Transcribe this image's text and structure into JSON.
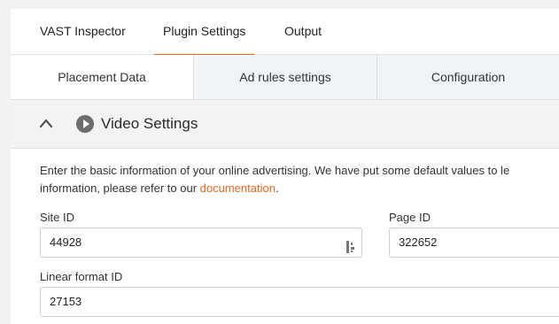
{
  "top_tabs": [
    "VAST Inspector",
    "Plugin Settings",
    "Output"
  ],
  "active_top_tab": "Plugin Settings",
  "sub_tabs": [
    "Placement Data",
    "Ad rules settings",
    "Configuration"
  ],
  "section": {
    "title": "Video Settings"
  },
  "description": {
    "line1": "Enter the basic information of your online advertising. We have put some default values to le",
    "line2_prefix": "information, please refer to our ",
    "link": "documentation",
    "line2_suffix": "."
  },
  "fields": {
    "site_id": {
      "label": "Site ID",
      "value": "44928"
    },
    "page_id": {
      "label": "Page ID",
      "value": "322652"
    },
    "linear_format_id": {
      "label": "Linear format ID",
      "value": "27153"
    }
  },
  "colors": {
    "accent": "#f26522",
    "link": "#e8651d"
  }
}
